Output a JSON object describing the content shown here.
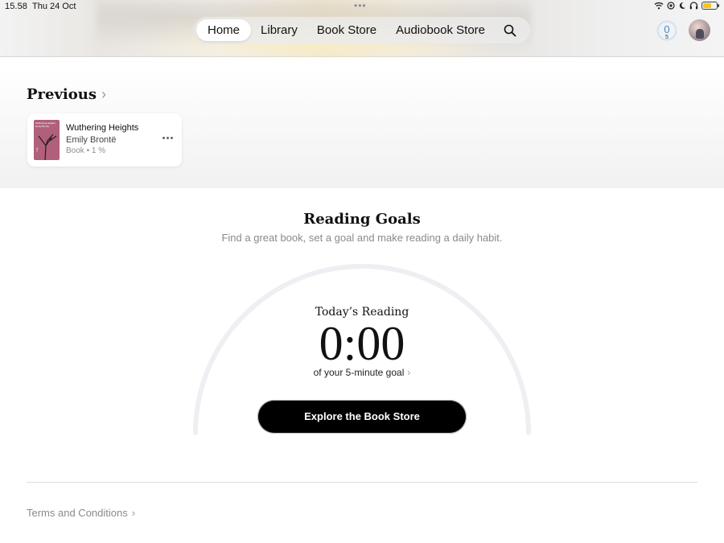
{
  "status_bar": {
    "time": "15.58",
    "date": "Thu 24 Oct",
    "multitask_dots": "•••",
    "icons": [
      "wifi-icon",
      "location-icon",
      "moon-icon",
      "headphones-icon",
      "battery-icon"
    ],
    "battery_color": "#f5c518"
  },
  "nav": {
    "tabs": [
      {
        "label": "Home",
        "active": true
      },
      {
        "label": "Library",
        "active": false
      },
      {
        "label": "Book Store",
        "active": false
      },
      {
        "label": "Audiobook Store",
        "active": false
      }
    ],
    "search_icon": "search-icon",
    "reading_goal_badge": {
      "value": "0",
      "sub": "5"
    },
    "avatar": "avatar"
  },
  "previous": {
    "title": "Previous",
    "chevron": "›",
    "book": {
      "title": "Wuthering Heights",
      "author": "Emily Brontë",
      "meta": "Book • 1 %",
      "cover_color": "#b0607a",
      "cover_text": "Wuthering Heights Emily Brontë"
    }
  },
  "reading_goals": {
    "title": "Reading Goals",
    "subtitle": "Find a great book, set a goal and make reading a daily habit.",
    "todays_label": "Today’s Reading",
    "time": "0:00",
    "goal_text": "of your 5-minute goal",
    "goal_chevron": "›",
    "progress_fraction": 0,
    "button_label": "Explore the Book Store"
  },
  "footer": {
    "terms_label": "Terms and Conditions",
    "terms_chevron": "›"
  },
  "colors": {
    "accent": "#3a8ed8",
    "button_bg": "#000000",
    "gauge_track": "#efeff3"
  }
}
